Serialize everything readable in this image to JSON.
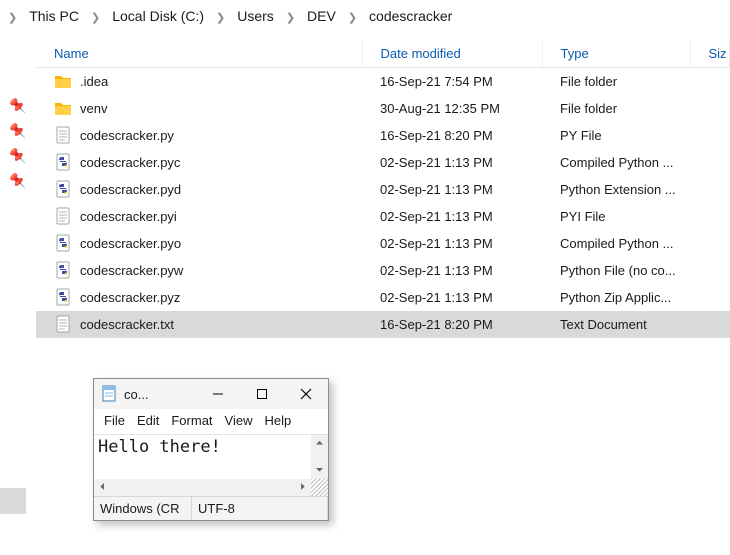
{
  "breadcrumb": [
    "This PC",
    "Local Disk (C:)",
    "Users",
    "DEV",
    "codescracker"
  ],
  "columns": {
    "name": "Name",
    "date": "Date modified",
    "type": "Type",
    "size": "Siz"
  },
  "files": [
    {
      "icon": "folder",
      "name": ".idea",
      "date": "16-Sep-21 7:54 PM",
      "type": "File folder"
    },
    {
      "icon": "folder",
      "name": "venv",
      "date": "30-Aug-21 12:35 PM",
      "type": "File folder"
    },
    {
      "icon": "doc",
      "name": "codescracker.py",
      "date": "16-Sep-21 8:20 PM",
      "type": "PY File"
    },
    {
      "icon": "py",
      "name": "codescracker.pyc",
      "date": "02-Sep-21 1:13 PM",
      "type": "Compiled Python ..."
    },
    {
      "icon": "py",
      "name": "codescracker.pyd",
      "date": "02-Sep-21 1:13 PM",
      "type": "Python Extension ..."
    },
    {
      "icon": "doc",
      "name": "codescracker.pyi",
      "date": "02-Sep-21 1:13 PM",
      "type": "PYI File"
    },
    {
      "icon": "py",
      "name": "codescracker.pyo",
      "date": "02-Sep-21 1:13 PM",
      "type": "Compiled Python ..."
    },
    {
      "icon": "py",
      "name": "codescracker.pyw",
      "date": "02-Sep-21 1:13 PM",
      "type": "Python File (no co..."
    },
    {
      "icon": "py",
      "name": "codescracker.pyz",
      "date": "02-Sep-21 1:13 PM",
      "type": "Python Zip Applic..."
    },
    {
      "icon": "doc",
      "name": "codescracker.txt",
      "date": "16-Sep-21 8:20 PM",
      "type": "Text Document",
      "selected": true
    }
  ],
  "notepad": {
    "title": "co...",
    "menu": [
      "File",
      "Edit",
      "Format",
      "View",
      "Help"
    ],
    "content": "Hello there!",
    "status_left": "Windows (CR",
    "status_right": "UTF-8"
  }
}
